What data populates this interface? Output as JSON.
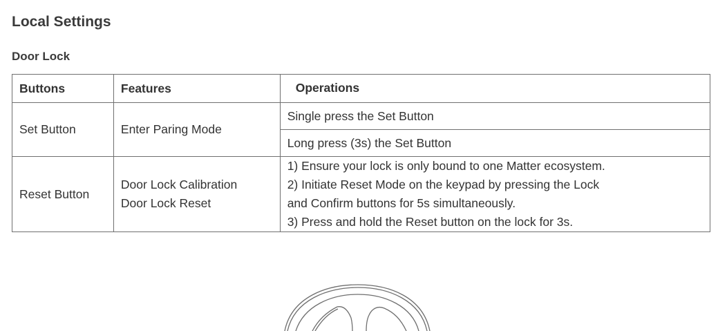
{
  "page_title": "Local Settings",
  "section_title": "Door Lock",
  "table": {
    "headers": [
      "Buttons",
      "Features",
      "Operations"
    ],
    "rows": [
      {
        "button": "Set Button",
        "feature": "Enter Paring Mode",
        "operations": [
          "Single press the Set Button",
          "Long press (3s) the Set Button"
        ]
      },
      {
        "button": "Reset Button",
        "features": [
          "Door Lock Calibration",
          "Door Lock Reset"
        ],
        "operations": [
          "1) Ensure your lock is only bound to one Matter ecosystem.",
          "2) Initiate Reset Mode on the keypad by pressing the Lock",
          "and Confirm buttons for 5s simultaneously.",
          "3) Press and hold the Reset button on the lock for 3s."
        ]
      }
    ]
  },
  "illustration": {
    "name": "door-lock-device-illustration",
    "stroke_color": "#6f6f6f"
  }
}
